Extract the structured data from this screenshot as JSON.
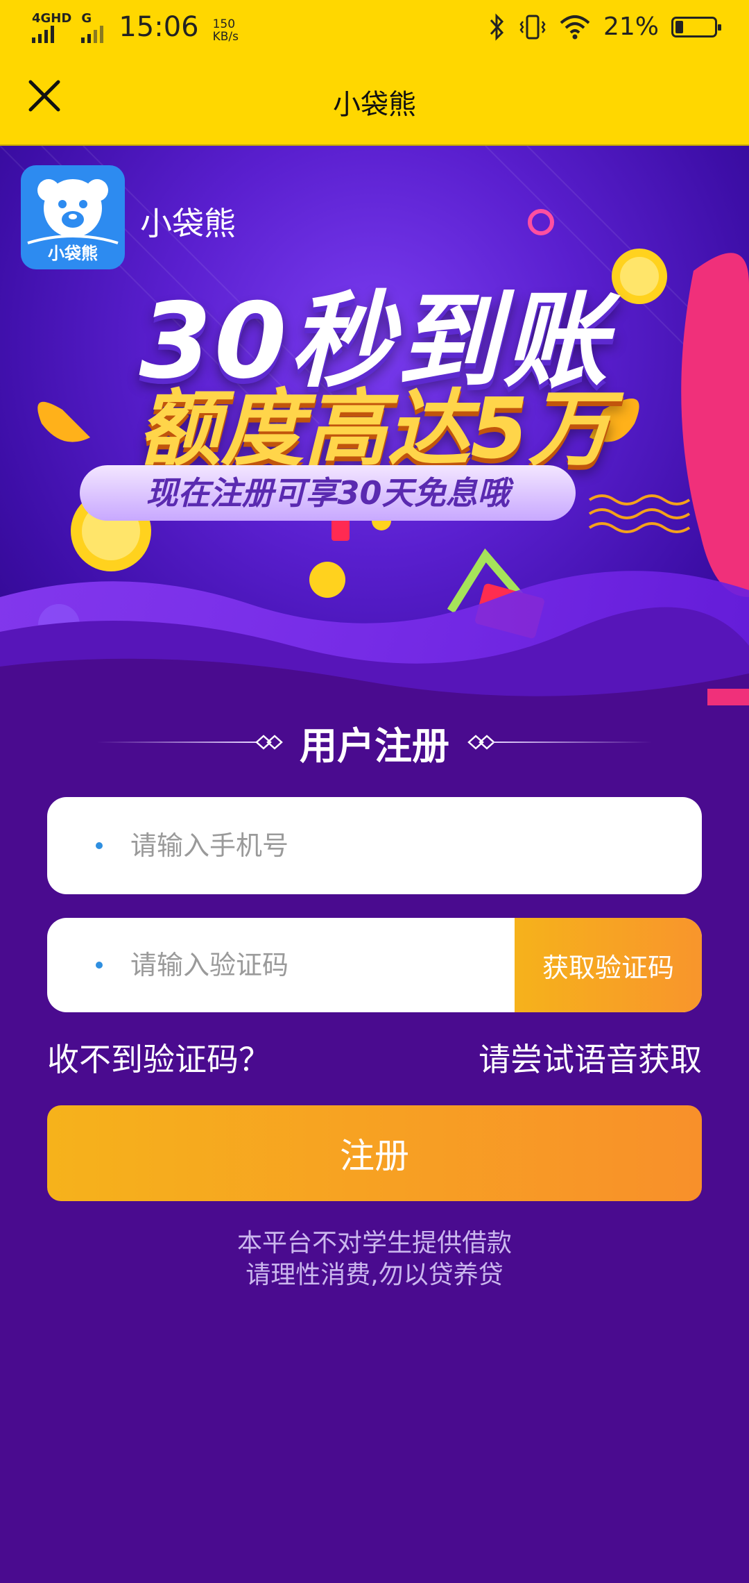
{
  "status_bar": {
    "network1": "4GHD",
    "network2": "G",
    "time": "15:06",
    "speed_value": "150",
    "speed_unit": "KB/s",
    "battery_percent": "21%",
    "battery_level": 0.21
  },
  "title_bar": {
    "title": "小袋熊",
    "close_icon": "close-icon"
  },
  "banner": {
    "logo_text": "小袋熊",
    "brand_name": "小袋熊",
    "headline_1": "30秒到账",
    "headline_2": "额度高达5万",
    "subline": "现在注册可享30天免息哦"
  },
  "form": {
    "section_title": "用户注册",
    "phone_placeholder": "请输入手机号",
    "code_placeholder": "请输入验证码",
    "get_code_label": "获取验证码",
    "no_code_text": "收不到验证码？",
    "voice_code_text": "请尝试语音获取",
    "register_label": "注册"
  },
  "notice": {
    "line1": "本平台不对学生提供借款",
    "line2": "请理性消费,勿以贷养贷"
  },
  "colors": {
    "status_bg": "#ffd700",
    "page_bg": "#4a0b8f",
    "accent_orange": "#f6a620",
    "input_dot": "#2f8fe0"
  }
}
